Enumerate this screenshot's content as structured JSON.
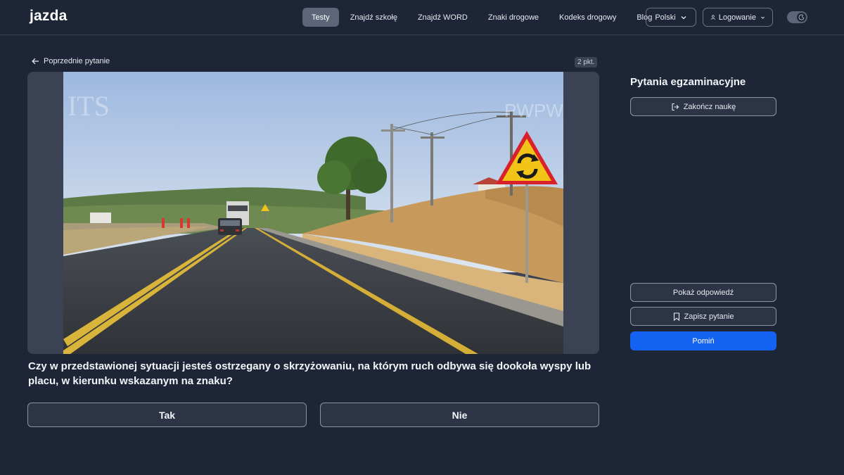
{
  "header": {
    "logo": "jazda",
    "nav": [
      {
        "label": "Testy",
        "active": true
      },
      {
        "label": "Znajdź szkołę"
      },
      {
        "label": "Znajdź WORD"
      },
      {
        "label": "Znaki drogowe"
      },
      {
        "label": "Kodeks drogowy"
      },
      {
        "label": "Blog"
      }
    ],
    "language": "Polski",
    "login": "Logowanie"
  },
  "question": {
    "prev_label": "Poprzednie pytanie",
    "points": "2 pkt.",
    "text": "Czy w przedstawionej sytuacji jesteś ostrzegany o skrzyżowaniu, na którym ruch odbywa się dookoła wyspy lub placu, w kierunku wskazanym na znaku?",
    "answers": [
      {
        "label": "Tak"
      },
      {
        "label": "Nie"
      }
    ],
    "watermark_left": "ITS",
    "watermark_right": "PWPW"
  },
  "sidebar": {
    "title": "Pytania egzaminacyjne",
    "end_label": "Zakończ naukę",
    "show_label": "Pokaż odpowiedź",
    "save_label": "Zapisz pytanie",
    "skip_label": "Pomiń"
  },
  "colors": {
    "background": "#1e2536",
    "accent": "#1463f3",
    "logo_accent": "#5b8cff"
  }
}
